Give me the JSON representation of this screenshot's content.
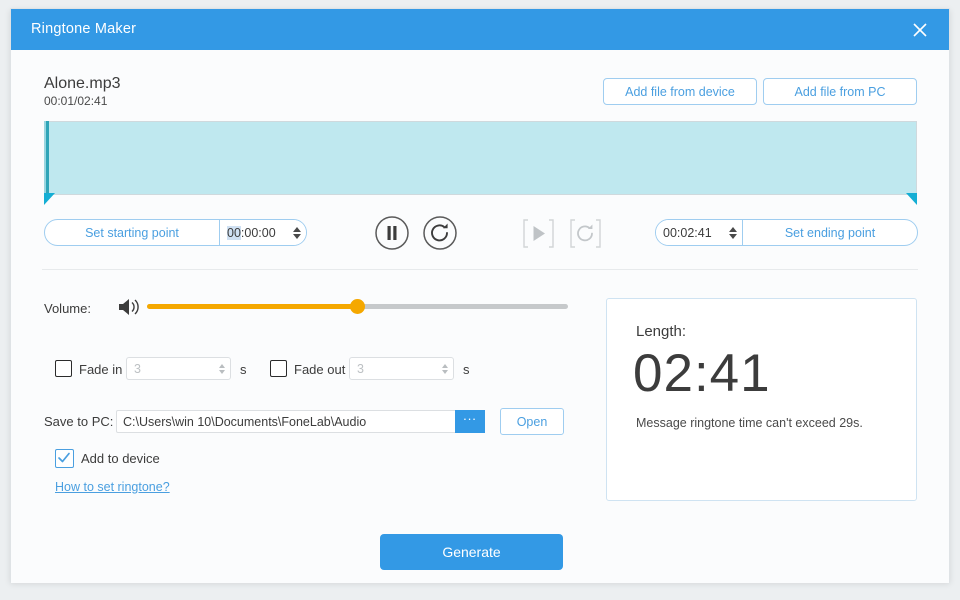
{
  "window": {
    "title": "Ringtone Maker",
    "close_icon": "close-icon"
  },
  "file": {
    "name": "Alone.mp3",
    "time": "00:01/02:41"
  },
  "toolbar": {
    "add_from_device": "Add file from device",
    "add_from_pc": "Add file from PC"
  },
  "trim": {
    "start_label": "Set starting point",
    "start_value_selected": "00",
    "start_value_rest": ":00:00",
    "end_value": "00:02:41",
    "end_label": "Set ending point",
    "pause_icon": "pause-icon",
    "reset_icon": "reset-icon",
    "play_icon_disabled": "play-icon",
    "loop_icon_disabled": "loop-icon"
  },
  "volume": {
    "label": "Volume:",
    "icon": "speaker-icon",
    "percent": 50
  },
  "fade": {
    "in_label": "Fade in",
    "in_value": "3",
    "in_unit": "s",
    "in_checked": false,
    "out_label": "Fade out",
    "out_value": "3",
    "out_unit": "s",
    "out_checked": false
  },
  "save": {
    "label": "Save to PC:",
    "path": "C:\\Users\\win 10\\Documents\\FoneLab\\Audio",
    "browse_label": "...",
    "open_label": "Open",
    "add_to_device_label": "Add to device",
    "add_to_device_checked": true,
    "how_to_link": "How to set ringtone?"
  },
  "length": {
    "title": "Length:",
    "value": "02:41",
    "note": "Message ringtone time can't exceed 29s."
  },
  "actions": {
    "generate": "Generate"
  },
  "colors": {
    "accent": "#3399e5",
    "link": "#4a9fe0",
    "wave": "#bfe8ef",
    "handle": "#14aed4",
    "volume": "#f5a800"
  }
}
